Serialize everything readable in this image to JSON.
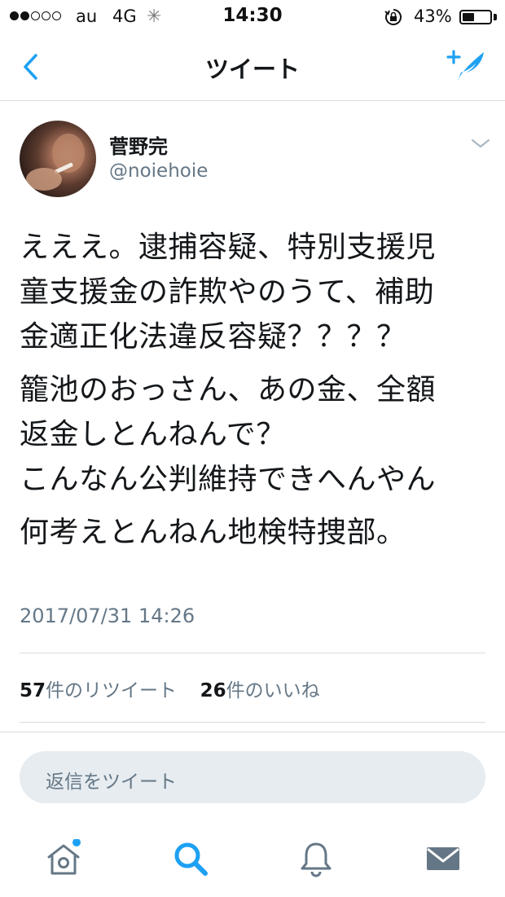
{
  "status_bar": {
    "carrier": "au",
    "network": "4G",
    "time": "14:30",
    "battery_percent_label": "43%",
    "battery_level": 0.43,
    "signal_strength": 2
  },
  "nav": {
    "title": "ツイート",
    "back_icon": "chevron-left-icon",
    "compose_icon": "compose-tweet-icon",
    "accent_color": "#1da1f2"
  },
  "tweet": {
    "display_name": "菅野完",
    "handle": "@noiehoie",
    "body_lines": [
      "えええ。逮捕容疑、特別支援児",
      "童支援金の詐欺やのうて、補助",
      "金適正化法違反容疑？？？？",
      "籠池のおっさん、あの金、全額",
      "返金しとんねんで？",
      "こんなん公判維持できへんやん",
      "何考えとんねん地検特捜部。"
    ],
    "timestamp": "2017/07/31 14:26",
    "retweet_count": "57",
    "retweet_label": "件のリツイート",
    "like_count": "26",
    "like_label": "件のいいね"
  },
  "reply": {
    "placeholder": "返信をツイート"
  },
  "tab_bar": {
    "items": [
      {
        "name": "home",
        "icon": "home-icon",
        "active": false,
        "badge": true
      },
      {
        "name": "search",
        "icon": "search-icon",
        "active": true
      },
      {
        "name": "notifications",
        "icon": "bell-icon",
        "active": false
      },
      {
        "name": "messages",
        "icon": "envelope-icon",
        "active": false
      }
    ]
  }
}
